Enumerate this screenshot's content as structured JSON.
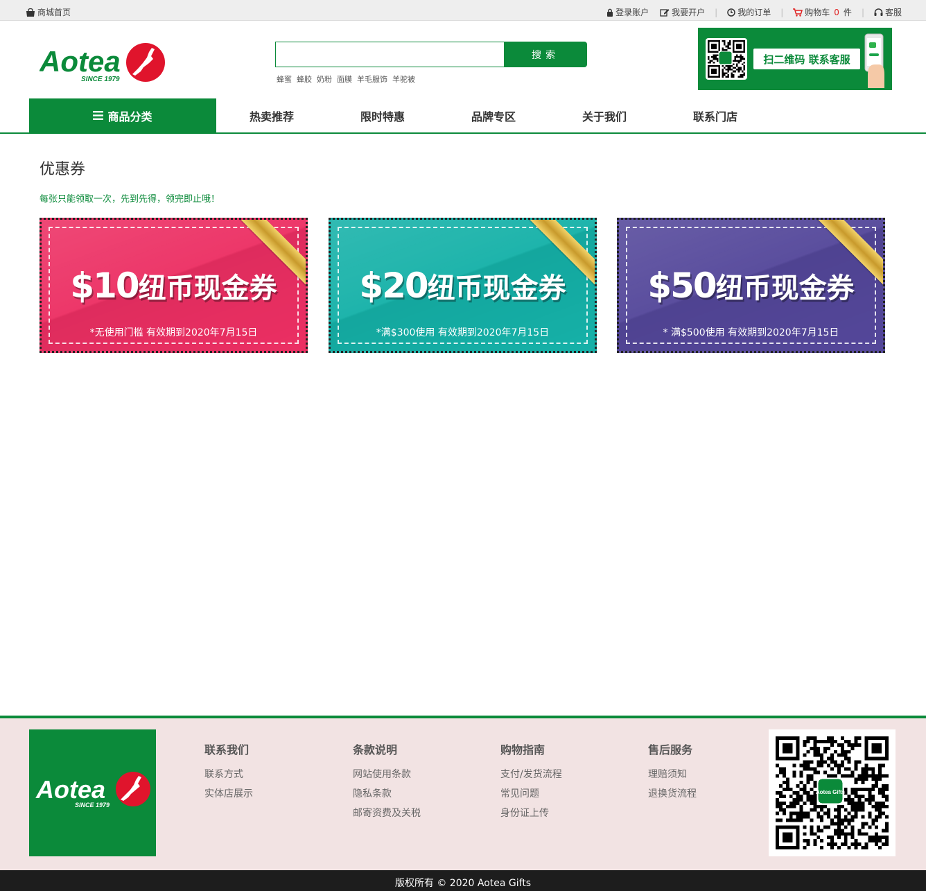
{
  "topbar": {
    "home_label": "商城首页",
    "login_label": "登录账户",
    "register_label": "我要开户",
    "orders_label": "我的订单",
    "cart_label": "购物车",
    "cart_count": "0",
    "cart_unit": "件",
    "service_label": "客服"
  },
  "logo": {
    "brand": "Aotea",
    "since": "SINCE 1979"
  },
  "search": {
    "value": "",
    "placeholder": "",
    "button_label": "搜索",
    "hotwords": [
      "蜂蜜",
      "蜂胶",
      "奶粉",
      "面膜",
      "羊毛服饰",
      "羊驼被"
    ]
  },
  "qr_banner": {
    "label": "扫二维码 联系客服"
  },
  "nav": {
    "category_label": "商品分类",
    "items": [
      "热卖推荐",
      "限时特惠",
      "品牌专区",
      "关于我们",
      "联系门店"
    ]
  },
  "main": {
    "title": "优惠券",
    "notice": "每张只能领取一次，先到先得，领完即止哦！"
  },
  "coupons": [
    {
      "amount": "$10",
      "text": "纽币现金券",
      "condition": "*无使用门槛 有效期到2020年7月15日",
      "color": "#ec2f63"
    },
    {
      "amount": "$20",
      "text": "纽币现金券",
      "condition": "*满$300使用 有效期到2020年7月15日",
      "color": "#15b1a8"
    },
    {
      "amount": "$50",
      "text": "纽币现金券",
      "condition": "* 满$500使用 有效期到2020年7月15日",
      "color": "#54479a"
    }
  ],
  "footer": {
    "columns": [
      {
        "title": "联系我们",
        "links": [
          "联系方式",
          "实体店展示"
        ]
      },
      {
        "title": "条款说明",
        "links": [
          "网站使用条款",
          "隐私条款",
          "邮寄资费及关税"
        ]
      },
      {
        "title": "购物指南",
        "links": [
          "支付/发货流程",
          "常见问题",
          "身份证上传"
        ]
      },
      {
        "title": "售后服务",
        "links": [
          "理赔须知",
          "退换货流程"
        ]
      }
    ],
    "qr_center_label": "Aotea Gifts"
  },
  "copyright": "版权所有 © 2020 Aotea Gifts",
  "colors": {
    "brand_green": "#0b8a3a",
    "accent_red": "#e02020",
    "footer_bg": "#f2e3e3"
  }
}
